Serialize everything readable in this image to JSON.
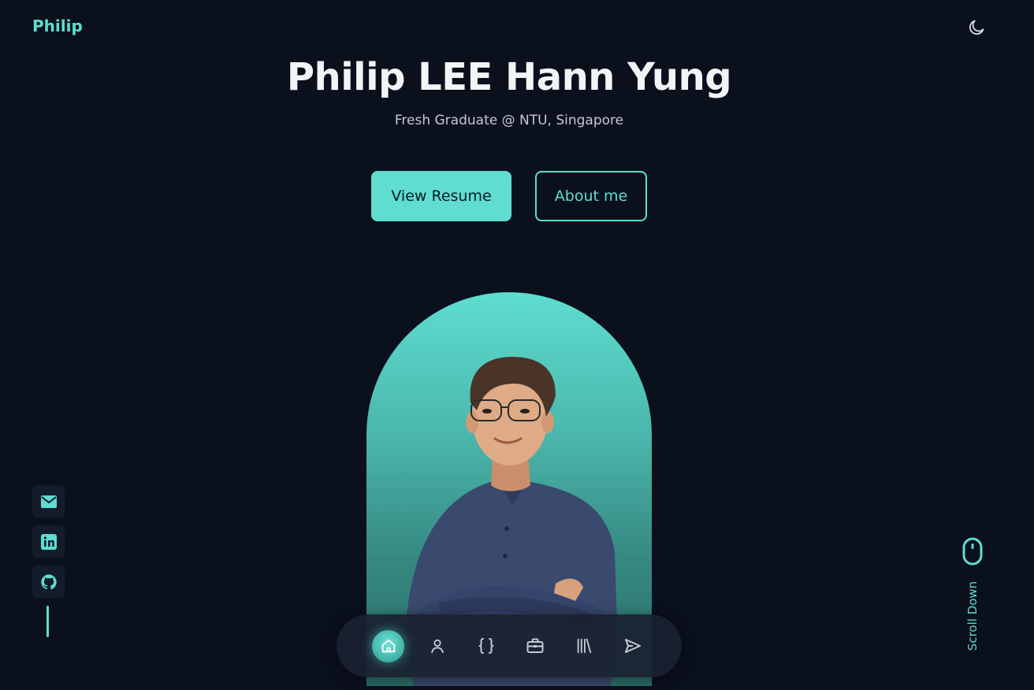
{
  "header": {
    "logo": "Philip",
    "theme_toggle_icon": "moon-icon"
  },
  "hero": {
    "name": "Philip LEE Hann Yung",
    "subtitle": "Fresh Graduate @ NTU, Singapore",
    "primary_button": "View Resume",
    "secondary_button": "About me",
    "portrait_icon": "profile-photo"
  },
  "social": {
    "items": [
      {
        "icon": "mail-icon"
      },
      {
        "icon": "linkedin-icon"
      },
      {
        "icon": "github-icon"
      }
    ]
  },
  "scroll": {
    "label": "Scroll Down",
    "icon": "mouse-icon"
  },
  "bottom_nav": {
    "active": "home",
    "items": [
      {
        "icon": "home-icon"
      },
      {
        "icon": "user-icon"
      },
      {
        "icon": "code-braces-icon"
      },
      {
        "icon": "briefcase-icon"
      },
      {
        "icon": "library-icon"
      },
      {
        "icon": "send-icon"
      }
    ]
  },
  "colors": {
    "background": "#0b101d",
    "accent": "#5eddd0",
    "text": "#f3f4f6",
    "muted_text": "#c5c9d3",
    "panel": "#141c2b"
  }
}
